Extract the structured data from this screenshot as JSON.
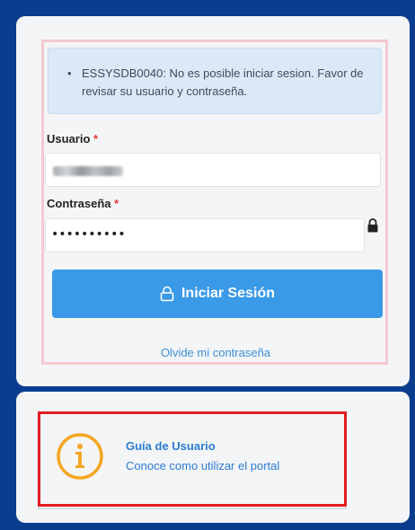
{
  "alert": {
    "bullet": "•",
    "message": "ESSYSDB0040: No es posible iniciar sesion. Favor de revisar su usuario y contraseña."
  },
  "form": {
    "username_label": "Usuario",
    "password_label": "Contraseña",
    "required_mark": "*",
    "password_mask": "••••••••••",
    "login_button": "Iniciar Sesión",
    "forgot_link": "Olvide mi contraseña"
  },
  "guide": {
    "title": "Guía de Usuario",
    "subtitle": "Conoce como utilizar el portal",
    "icon": "info-icon"
  },
  "colors": {
    "background": "#0b3d8f",
    "card": "#f4f5f7",
    "alert_bg": "#dbe9f7",
    "button": "#3a9ae8",
    "link": "#2b7cd3",
    "required": "#e53935",
    "highlight_red": "#e11d24",
    "info_orange": "#f5a623"
  }
}
